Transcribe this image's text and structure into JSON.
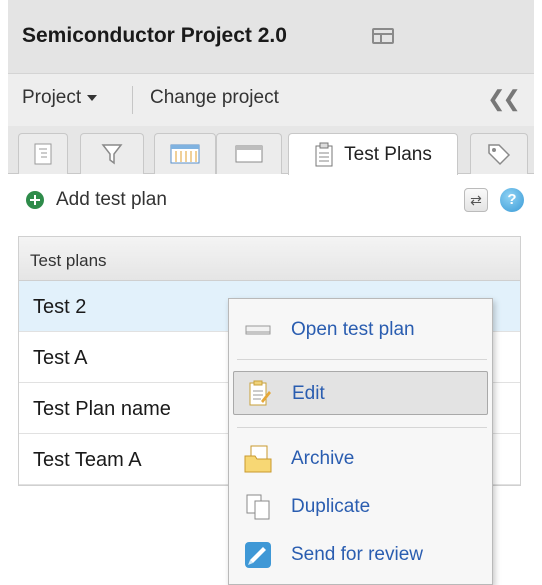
{
  "header": {
    "title": "Semiconductor Project 2.0",
    "window_icon": "window-icon"
  },
  "toolbar": {
    "project_label": "Project",
    "change_project_label": "Change project",
    "collapse_icon": "double-chevron-left-icon"
  },
  "tabs": [
    {
      "name": "tab-tree",
      "icon": "tree-list-icon",
      "label": ""
    },
    {
      "name": "tab-filter",
      "icon": "filter-icon",
      "label": ""
    },
    {
      "name": "tab-calendar",
      "icon": "calendar-grid-icon",
      "label": ""
    },
    {
      "name": "tab-panel",
      "icon": "panel-icon",
      "label": ""
    },
    {
      "name": "tab-test-plans",
      "icon": "clipboard-icon",
      "label": "Test Plans",
      "active": true
    },
    {
      "name": "tab-tags",
      "icon": "tag-icon",
      "label": ""
    }
  ],
  "actions": {
    "add_label": "Add test plan",
    "add_icon": "add-circle-icon",
    "refresh_icon": "refresh-icon",
    "help_icon": "help-icon",
    "help_text": "?"
  },
  "grid": {
    "header": "Test plans",
    "rows": [
      "Test 2",
      "Test A",
      "Test Plan name",
      "Test Team A"
    ],
    "selected_row": "Test 2"
  },
  "context_menu": {
    "items": [
      {
        "label": "Open test plan",
        "icon": "open-plan-icon"
      },
      {
        "label": "Edit",
        "icon": "edit-icon",
        "hovered": true
      },
      {
        "label": "Archive",
        "icon": "archive-icon"
      },
      {
        "label": "Duplicate",
        "icon": "duplicate-icon"
      },
      {
        "label": "Send for review",
        "icon": "send-review-icon"
      }
    ]
  },
  "colors": {
    "accent": "#2a5db0",
    "add_green": "#2e8b4a",
    "selected_row": "#e2f1fb"
  }
}
